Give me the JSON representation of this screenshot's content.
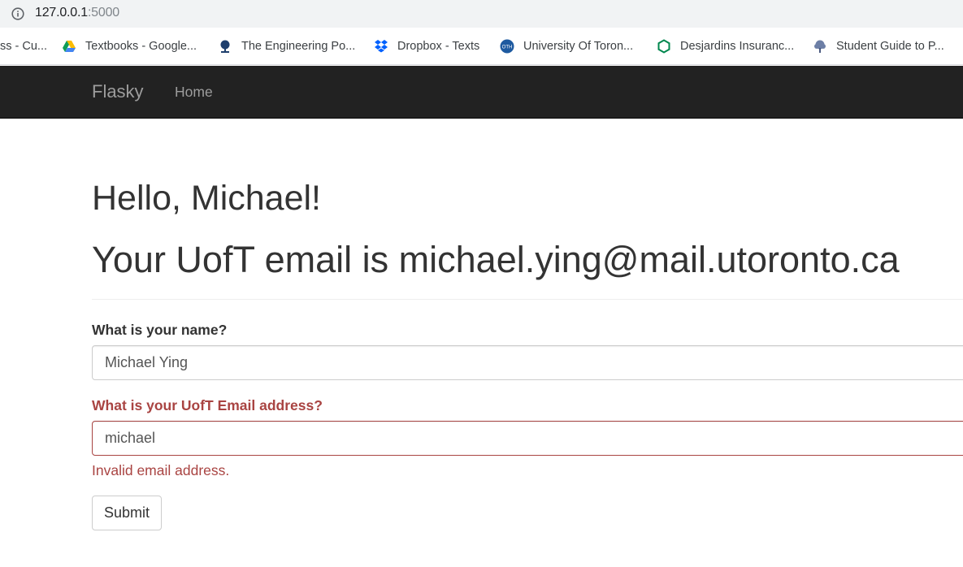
{
  "browser": {
    "url_host": "127.0.0.1",
    "url_port": ":5000",
    "info_icon": "info-icon",
    "bookmarks": [
      {
        "label": "ss - Cu...",
        "icon": "none"
      },
      {
        "label": "Textbooks - Google...",
        "icon": "google-drive-icon"
      },
      {
        "label": "The Engineering Po...",
        "icon": "engineering-crest-icon"
      },
      {
        "label": "Dropbox - Texts",
        "icon": "dropbox-icon"
      },
      {
        "label": "University Of Toron...",
        "icon": "university-badge-icon"
      },
      {
        "label": "Desjardins Insuranc...",
        "icon": "hexagon-icon"
      },
      {
        "label": "Student Guide to P...",
        "icon": "tree-crest-icon"
      }
    ]
  },
  "navbar": {
    "brand": "Flasky",
    "links": [
      "Home"
    ]
  },
  "main": {
    "greeting": "Hello, Michael!",
    "email_line": "Your UofT email is michael.ying@mail.utoronto.ca"
  },
  "form": {
    "name_label": "What is your name?",
    "name_value": "Michael Ying",
    "email_label": "What is your UofT Email address?",
    "email_value": "michael",
    "email_error": "Invalid email address.",
    "submit_label": "Submit"
  },
  "colors": {
    "navbar_bg": "#222222",
    "error": "#a94442",
    "text": "#333333"
  }
}
